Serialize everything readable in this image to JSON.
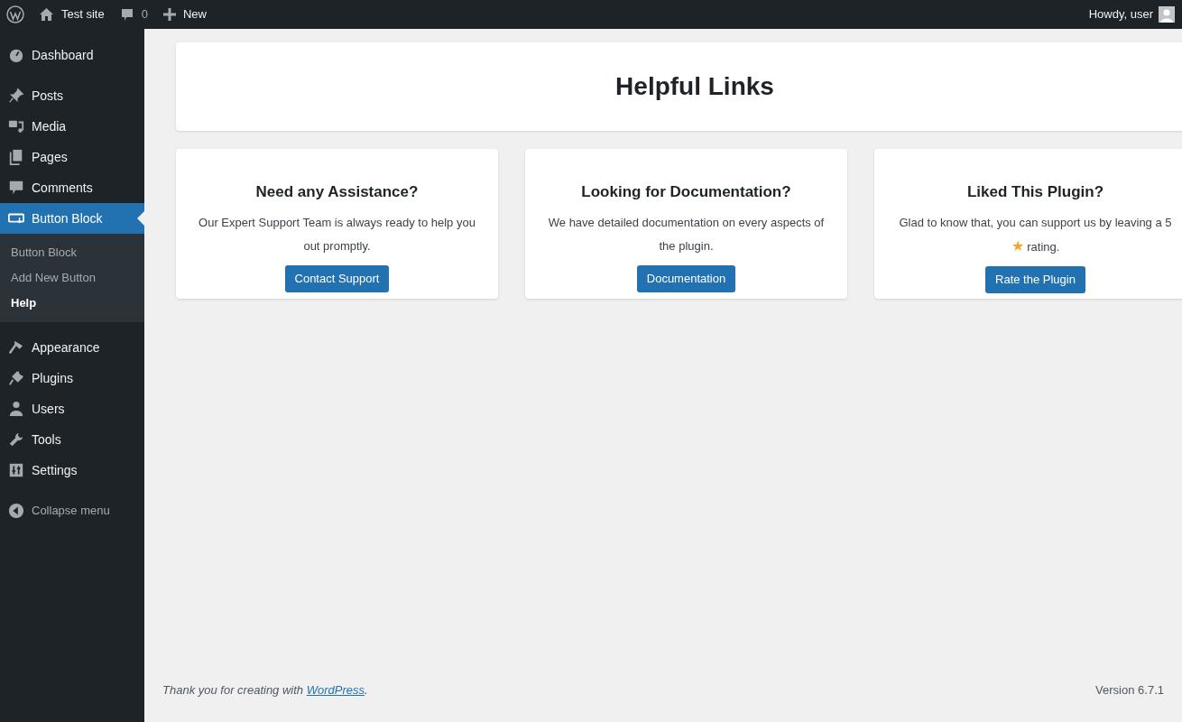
{
  "admin_bar": {
    "site": "Test site",
    "comments_count": "0",
    "new_label": "New",
    "greeting": "Howdy, user"
  },
  "sidebar": {
    "items": [
      {
        "label": "Dashboard",
        "selected": false
      },
      {
        "label": "Posts",
        "selected": false
      },
      {
        "label": "Media",
        "selected": false
      },
      {
        "label": "Pages",
        "selected": false
      },
      {
        "label": "Comments",
        "selected": false
      },
      {
        "label": "Button Block",
        "selected": true,
        "children": [
          {
            "label": "Button Block",
            "selected": false
          },
          {
            "label": "Add New Button",
            "selected": false
          },
          {
            "label": "Help",
            "selected": true
          }
        ]
      },
      {
        "label": "Appearance",
        "selected": false
      },
      {
        "label": "Plugins",
        "selected": false
      },
      {
        "label": "Users",
        "selected": false
      },
      {
        "label": "Tools",
        "selected": false
      },
      {
        "label": "Settings",
        "selected": false
      }
    ],
    "collapse": "Collapse menu"
  },
  "page_title": "Helpful Links",
  "cards": [
    {
      "title": "Need any Assistance?",
      "description": [
        {
          "kind": "text",
          "text": "Our Expert Support Team is always ready to help you out promptly."
        }
      ],
      "button": "Contact Support"
    },
    {
      "title": "Looking for Documentation?",
      "description": [
        {
          "kind": "text",
          "text": "We have detailed documentation on every aspects of the plugin."
        }
      ],
      "button": "Documentation"
    },
    {
      "title": "Liked This Plugin?",
      "description": [
        {
          "kind": "text",
          "text": "Glad to know that, you can support us by leaving a 5 "
        },
        {
          "kind": "star",
          "text": "★"
        },
        {
          "kind": "text",
          "text": " rating."
        }
      ],
      "button": "Rate the Plugin"
    }
  ],
  "footer": {
    "thanks": "Thank you for creating with ",
    "link": "WordPress",
    "after": ".",
    "version": "Version 6.7.1"
  }
}
